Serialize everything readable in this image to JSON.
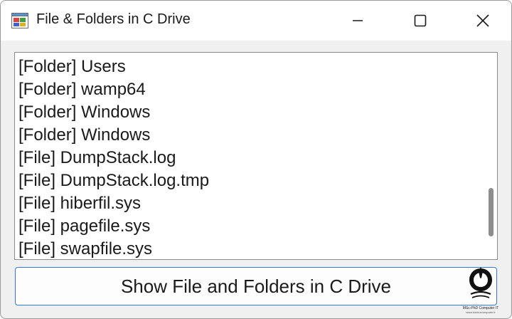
{
  "window": {
    "title": "File & Folders in C Drive",
    "icon": "windows-form-icon"
  },
  "titlebar_buttons": [
    {
      "name": "minimize-icon"
    },
    {
      "name": "maximize-icon"
    },
    {
      "name": "close-icon"
    }
  ],
  "listbox": {
    "items": [
      "[Folder] Users",
      "[Folder] wamp64",
      "[Folder] Windows",
      "[Folder] Windows",
      "[File] DumpStack.log",
      "[File] DumpStack.log.tmp",
      "[File] hiberfil.sys",
      "[File] pagefile.sys",
      "[File] swapfile.sys"
    ],
    "scroll_position": 0.85
  },
  "action_button": {
    "label": "Show File and Folders in C Drive"
  },
  "watermark": {
    "line1": "MSc-PhD Computer IT",
    "line2": "www.konkurcomputer.ir"
  },
  "colors": {
    "accent": "#2f7bd6",
    "window_bg": "#f0f0f0",
    "scroll_thumb": "#8d8d8d"
  }
}
